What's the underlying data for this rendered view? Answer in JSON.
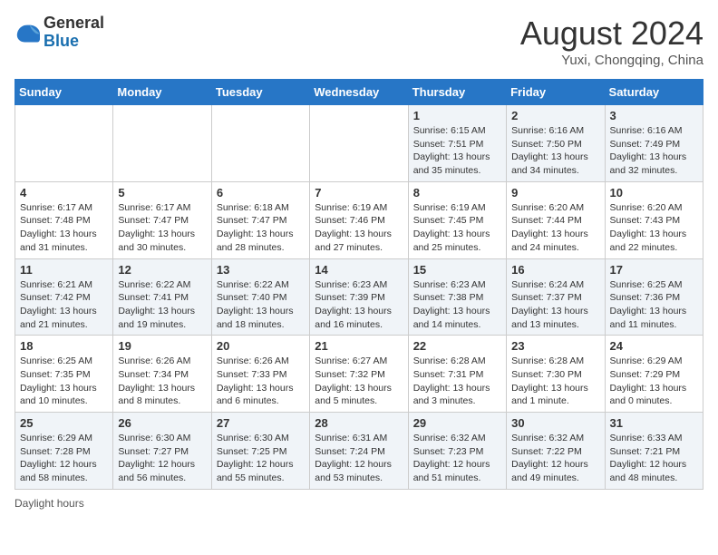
{
  "header": {
    "logo_general": "General",
    "logo_blue": "Blue",
    "month_title": "August 2024",
    "location": "Yuxi, Chongqing, China"
  },
  "days_of_week": [
    "Sunday",
    "Monday",
    "Tuesday",
    "Wednesday",
    "Thursday",
    "Friday",
    "Saturday"
  ],
  "weeks": [
    [
      {
        "day": "",
        "info": ""
      },
      {
        "day": "",
        "info": ""
      },
      {
        "day": "",
        "info": ""
      },
      {
        "day": "",
        "info": ""
      },
      {
        "day": "1",
        "info": "Sunrise: 6:15 AM\nSunset: 7:51 PM\nDaylight: 13 hours and 35 minutes."
      },
      {
        "day": "2",
        "info": "Sunrise: 6:16 AM\nSunset: 7:50 PM\nDaylight: 13 hours and 34 minutes."
      },
      {
        "day": "3",
        "info": "Sunrise: 6:16 AM\nSunset: 7:49 PM\nDaylight: 13 hours and 32 minutes."
      }
    ],
    [
      {
        "day": "4",
        "info": "Sunrise: 6:17 AM\nSunset: 7:48 PM\nDaylight: 13 hours and 31 minutes."
      },
      {
        "day": "5",
        "info": "Sunrise: 6:17 AM\nSunset: 7:47 PM\nDaylight: 13 hours and 30 minutes."
      },
      {
        "day": "6",
        "info": "Sunrise: 6:18 AM\nSunset: 7:47 PM\nDaylight: 13 hours and 28 minutes."
      },
      {
        "day": "7",
        "info": "Sunrise: 6:19 AM\nSunset: 7:46 PM\nDaylight: 13 hours and 27 minutes."
      },
      {
        "day": "8",
        "info": "Sunrise: 6:19 AM\nSunset: 7:45 PM\nDaylight: 13 hours and 25 minutes."
      },
      {
        "day": "9",
        "info": "Sunrise: 6:20 AM\nSunset: 7:44 PM\nDaylight: 13 hours and 24 minutes."
      },
      {
        "day": "10",
        "info": "Sunrise: 6:20 AM\nSunset: 7:43 PM\nDaylight: 13 hours and 22 minutes."
      }
    ],
    [
      {
        "day": "11",
        "info": "Sunrise: 6:21 AM\nSunset: 7:42 PM\nDaylight: 13 hours and 21 minutes."
      },
      {
        "day": "12",
        "info": "Sunrise: 6:22 AM\nSunset: 7:41 PM\nDaylight: 13 hours and 19 minutes."
      },
      {
        "day": "13",
        "info": "Sunrise: 6:22 AM\nSunset: 7:40 PM\nDaylight: 13 hours and 18 minutes."
      },
      {
        "day": "14",
        "info": "Sunrise: 6:23 AM\nSunset: 7:39 PM\nDaylight: 13 hours and 16 minutes."
      },
      {
        "day": "15",
        "info": "Sunrise: 6:23 AM\nSunset: 7:38 PM\nDaylight: 13 hours and 14 minutes."
      },
      {
        "day": "16",
        "info": "Sunrise: 6:24 AM\nSunset: 7:37 PM\nDaylight: 13 hours and 13 minutes."
      },
      {
        "day": "17",
        "info": "Sunrise: 6:25 AM\nSunset: 7:36 PM\nDaylight: 13 hours and 11 minutes."
      }
    ],
    [
      {
        "day": "18",
        "info": "Sunrise: 6:25 AM\nSunset: 7:35 PM\nDaylight: 13 hours and 10 minutes."
      },
      {
        "day": "19",
        "info": "Sunrise: 6:26 AM\nSunset: 7:34 PM\nDaylight: 13 hours and 8 minutes."
      },
      {
        "day": "20",
        "info": "Sunrise: 6:26 AM\nSunset: 7:33 PM\nDaylight: 13 hours and 6 minutes."
      },
      {
        "day": "21",
        "info": "Sunrise: 6:27 AM\nSunset: 7:32 PM\nDaylight: 13 hours and 5 minutes."
      },
      {
        "day": "22",
        "info": "Sunrise: 6:28 AM\nSunset: 7:31 PM\nDaylight: 13 hours and 3 minutes."
      },
      {
        "day": "23",
        "info": "Sunrise: 6:28 AM\nSunset: 7:30 PM\nDaylight: 13 hours and 1 minute."
      },
      {
        "day": "24",
        "info": "Sunrise: 6:29 AM\nSunset: 7:29 PM\nDaylight: 13 hours and 0 minutes."
      }
    ],
    [
      {
        "day": "25",
        "info": "Sunrise: 6:29 AM\nSunset: 7:28 PM\nDaylight: 12 hours and 58 minutes."
      },
      {
        "day": "26",
        "info": "Sunrise: 6:30 AM\nSunset: 7:27 PM\nDaylight: 12 hours and 56 minutes."
      },
      {
        "day": "27",
        "info": "Sunrise: 6:30 AM\nSunset: 7:25 PM\nDaylight: 12 hours and 55 minutes."
      },
      {
        "day": "28",
        "info": "Sunrise: 6:31 AM\nSunset: 7:24 PM\nDaylight: 12 hours and 53 minutes."
      },
      {
        "day": "29",
        "info": "Sunrise: 6:32 AM\nSunset: 7:23 PM\nDaylight: 12 hours and 51 minutes."
      },
      {
        "day": "30",
        "info": "Sunrise: 6:32 AM\nSunset: 7:22 PM\nDaylight: 12 hours and 49 minutes."
      },
      {
        "day": "31",
        "info": "Sunrise: 6:33 AM\nSunset: 7:21 PM\nDaylight: 12 hours and 48 minutes."
      }
    ]
  ],
  "footer": {
    "daylight_label": "Daylight hours"
  }
}
